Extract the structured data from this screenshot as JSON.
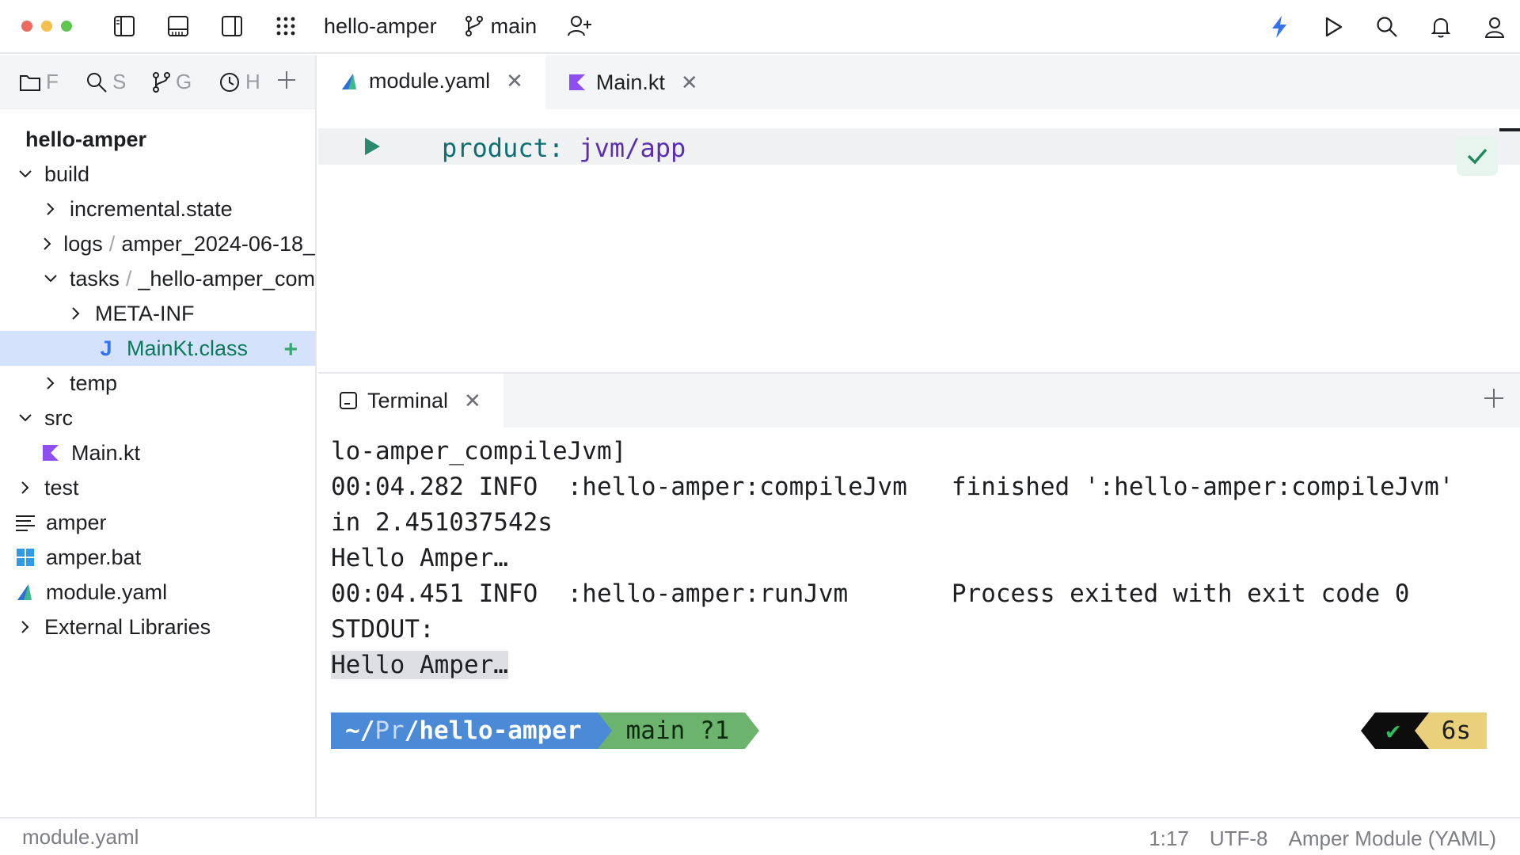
{
  "window": {
    "project_name": "hello-amper",
    "branch": "main"
  },
  "sidebar": {
    "tabs": [
      {
        "icon": "folder-icon",
        "label": "F"
      },
      {
        "icon": "search-icon",
        "label": "S"
      },
      {
        "icon": "git-branch-icon",
        "label": "G"
      },
      {
        "icon": "clock-icon",
        "label": "H"
      }
    ],
    "project_title": "hello-amper",
    "tree": [
      {
        "label": "build",
        "expanded": true
      },
      {
        "label": "incremental.state",
        "expanded": false
      },
      {
        "label": "logs",
        "crumb": "amper_2024-06-18_",
        "expanded": false
      },
      {
        "label": "tasks",
        "crumb": "_hello-amper_com",
        "expanded": true
      },
      {
        "label": "META-INF",
        "expanded": false
      },
      {
        "label": "MainKt.class",
        "selected": true
      },
      {
        "label": "temp",
        "expanded": false
      },
      {
        "label": "src",
        "expanded": true
      },
      {
        "label": "Main.kt"
      },
      {
        "label": "test",
        "expanded": false
      },
      {
        "label": "amper"
      },
      {
        "label": "amper.bat"
      },
      {
        "label": "module.yaml"
      },
      {
        "label": "External Libraries",
        "expanded": false
      }
    ],
    "selected_class_icon": "J"
  },
  "editor": {
    "tabs": [
      {
        "label": "module.yaml",
        "active": true
      },
      {
        "label": "Main.kt",
        "active": false
      }
    ],
    "code": {
      "key": "product",
      "colon": ":",
      "value": "jvm/app"
    }
  },
  "terminal": {
    "tab_label": "Terminal",
    "lines": [
      "lo-amper_compileJvm]",
      "00:04.282 INFO  :hello-amper:compileJvm   finished ':hello-amper:compileJvm'",
      "in 2.451037542s",
      "Hello Amper…",
      "00:04.451 INFO  :hello-amper:runJvm       Process exited with exit code 0",
      "STDOUT:"
    ],
    "highlighted_line": "Hello Amper…",
    "prompt": {
      "path_home": "~/",
      "path_dim": "Pr",
      "path_rest": "/hello-amper",
      "branch": "main ?1",
      "status_ok": "✔",
      "duration": "6s"
    }
  },
  "statusbar": {
    "file": "module.yaml",
    "position": "1:17",
    "encoding": "UTF-8",
    "file_type": "Amper Module (YAML)"
  },
  "colors": {
    "selection": "#d4e2fb",
    "prompt_path": "#4a8ad6",
    "prompt_branch": "#6cb36d",
    "prompt_time": "#ead07a",
    "accent_run": "#2b8a6e",
    "kotlin_purple": "#8e4ff0"
  }
}
